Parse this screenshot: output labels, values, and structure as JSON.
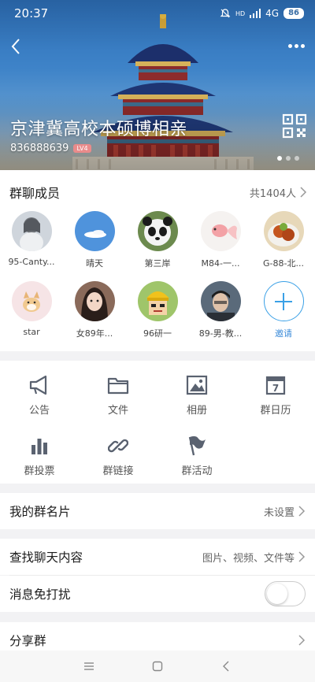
{
  "status_bar": {
    "time": "20:37",
    "network": "4G",
    "battery": "86",
    "signal_label": "HD"
  },
  "header": {
    "group_name": "京津冀高校本硕博相亲",
    "group_id": "836888639",
    "level": "LV4",
    "carousel": {
      "count": 3,
      "active": 0
    }
  },
  "members": {
    "title": "群聊成员",
    "count": "共1404人",
    "list": [
      {
        "name": "95-Canty...",
        "avatar": "sketch-portrait"
      },
      {
        "name": "晴天",
        "avatar": "blue-sky-cloud"
      },
      {
        "name": "第三岸",
        "avatar": "panda"
      },
      {
        "name": "M84-一...",
        "avatar": "goldfish"
      },
      {
        "name": "G-88-北...",
        "avatar": "food-plate"
      },
      {
        "name": "star",
        "avatar": "shiba-dog"
      },
      {
        "name": "女89年...",
        "avatar": "girl-photo"
      },
      {
        "name": "96研一",
        "avatar": "cartoon-miner"
      },
      {
        "name": "89-男-教...",
        "avatar": "man-photo"
      }
    ],
    "invite_label": "邀请"
  },
  "apps": [
    {
      "label": "公告",
      "icon": "megaphone-icon"
    },
    {
      "label": "文件",
      "icon": "folder-icon"
    },
    {
      "label": "相册",
      "icon": "album-icon"
    },
    {
      "label": "群日历",
      "icon": "calendar-icon",
      "calendar_day": "7"
    },
    {
      "label": "群投票",
      "icon": "vote-icon"
    },
    {
      "label": "群链接",
      "icon": "link-icon"
    },
    {
      "label": "群活动",
      "icon": "flag-icon"
    }
  ],
  "settings": {
    "card_name_label": "我的群名片",
    "card_name_value": "未设置",
    "search_label": "查找聊天内容",
    "search_value": "图片、视频、文件等",
    "mute_label": "消息免打扰",
    "mute_on": false,
    "share_label": "分享群"
  },
  "colors": {
    "accent": "#3b8bd9",
    "icon_gray": "#5a6270",
    "level_badge": "#e98b8b"
  }
}
